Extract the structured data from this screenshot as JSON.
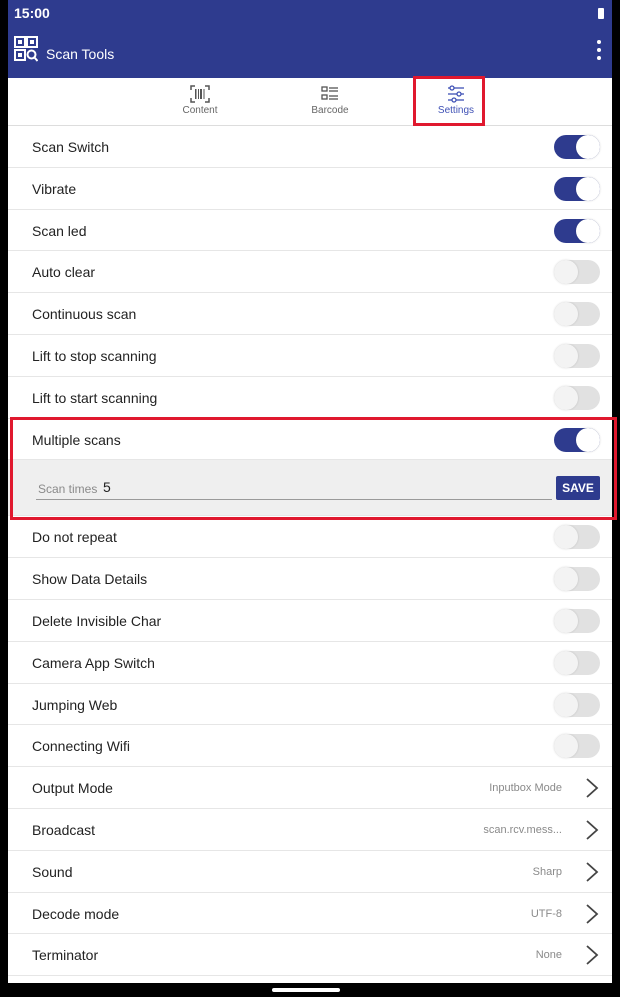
{
  "status_bar": {
    "time": "15:00"
  },
  "app_bar": {
    "title": "Scan Tools"
  },
  "tabs": [
    {
      "label": "Content",
      "icon": "barcode-scan-icon",
      "active": false
    },
    {
      "label": "Barcode",
      "icon": "list-icon",
      "active": false
    },
    {
      "label": "Settings",
      "icon": "sliders-icon",
      "active": true
    }
  ],
  "colors": {
    "primary": "#2e3b8e",
    "accent": "#3f51b5",
    "highlight": "#e0182e"
  },
  "settings": [
    {
      "label": "Scan Switch",
      "type": "toggle",
      "on": true
    },
    {
      "label": "Vibrate",
      "type": "toggle",
      "on": true
    },
    {
      "label": "Scan led",
      "type": "toggle",
      "on": true
    },
    {
      "label": "Auto clear",
      "type": "toggle",
      "on": false
    },
    {
      "label": "Continuous scan",
      "type": "toggle",
      "on": false
    },
    {
      "label": "Lift to stop scanning",
      "type": "toggle",
      "on": false
    },
    {
      "label": "Lift to start scanning",
      "type": "toggle",
      "on": false
    },
    {
      "label": "Multiple scans",
      "type": "toggle",
      "on": true
    },
    {
      "label": "Do not repeat",
      "type": "toggle",
      "on": false
    },
    {
      "label": "Show Data Details",
      "type": "toggle",
      "on": false
    },
    {
      "label": "Delete Invisible Char",
      "type": "toggle",
      "on": false
    },
    {
      "label": "Camera App Switch",
      "type": "toggle",
      "on": false
    },
    {
      "label": "Jumping Web",
      "type": "toggle",
      "on": false
    },
    {
      "label": "Connecting Wifi",
      "type": "toggle",
      "on": false
    },
    {
      "label": "Output Mode",
      "type": "link",
      "value": "Inputbox Mode"
    },
    {
      "label": "Broadcast",
      "type": "link",
      "value": "scan.rcv.mess..."
    },
    {
      "label": "Sound",
      "type": "link",
      "value": "Sharp"
    },
    {
      "label": "Decode mode",
      "type": "link",
      "value": "UTF-8"
    },
    {
      "label": "Terminator",
      "type": "link",
      "value": "None"
    }
  ],
  "scan_times": {
    "label": "Scan times",
    "value": "5",
    "save_label": "SAVE"
  }
}
